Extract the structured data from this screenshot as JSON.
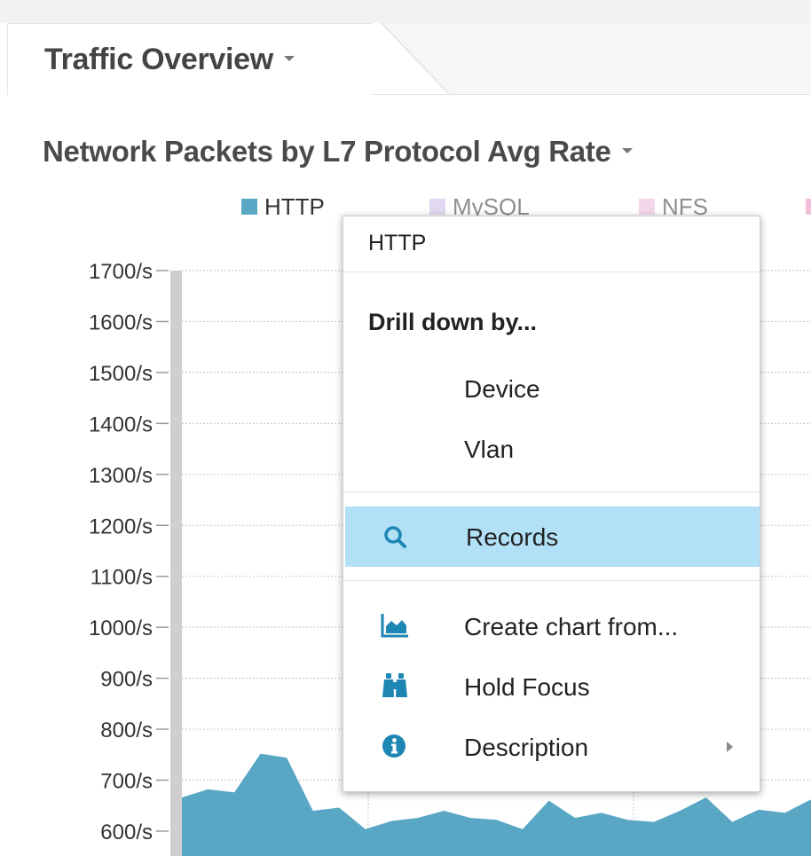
{
  "tab": {
    "title": "Traffic Overview"
  },
  "chart_title": "Network Packets by L7 Protocol Avg Rate",
  "legend": [
    {
      "label": "HTTP",
      "color": "#5aa7c5"
    },
    {
      "label": "MySQL",
      "color": "#c9b8e6"
    },
    {
      "label": "NFS",
      "color": "#e9b5dc"
    }
  ],
  "chart_data": {
    "type": "area",
    "title": "Network Packets by L7 Protocol Avg Rate",
    "y_unit": "/s",
    "ylim": [
      550,
      1750
    ],
    "yticks": [
      "1700/s",
      "1600/s",
      "1500/s",
      "1400/s",
      "1300/s",
      "1200/s",
      "1100/s",
      "1000/s",
      "900/s",
      "800/s",
      "700/s",
      "600/s"
    ],
    "grid": "dotted horizontal",
    "series": [
      {
        "name": "HTTP",
        "color": "#5aa7c5",
        "values": [
          666,
          682,
          676,
          752,
          744,
          640,
          646,
          604,
          620,
          626,
          640,
          626,
          622,
          604,
          660,
          626,
          636,
          622,
          618,
          640,
          666,
          618,
          642,
          636,
          662
        ]
      }
    ]
  },
  "context_menu": {
    "header": "HTTP",
    "drill_label": "Drill down by...",
    "items": [
      {
        "label": "Device",
        "icon": ""
      },
      {
        "label": "Vlan",
        "icon": ""
      },
      {
        "label": "Records",
        "icon": "search-icon",
        "highlighted": true
      },
      {
        "label": "Create chart from...",
        "icon": "area-chart-icon"
      },
      {
        "label": "Hold Focus",
        "icon": "binoculars-icon"
      },
      {
        "label": "Description",
        "icon": "info-icon",
        "has_submenu": true
      }
    ]
  },
  "colors": {
    "accent": "#1d8fbd",
    "highlight": "#b2e1f7",
    "area_fill": "#5aa7c5"
  }
}
